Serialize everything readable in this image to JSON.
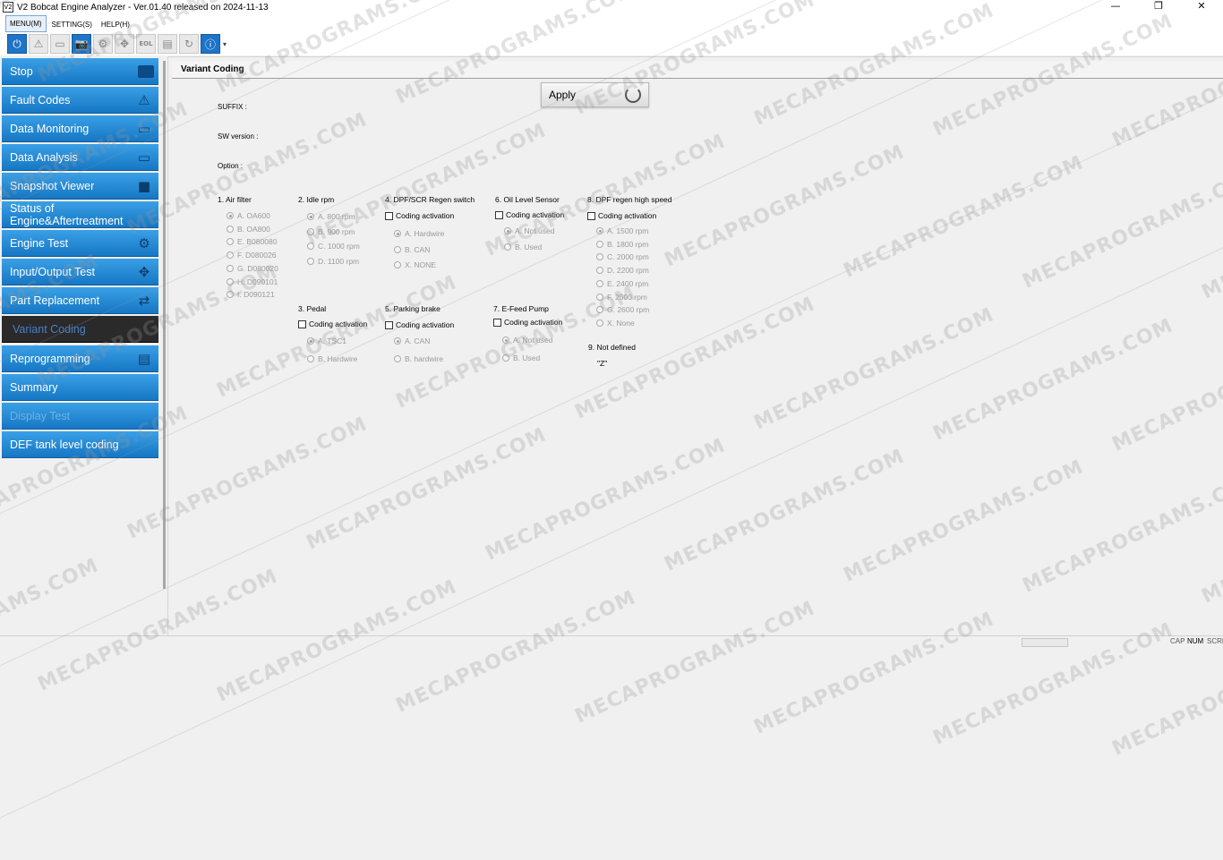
{
  "window": {
    "app_icon_text": "V2",
    "title": "V2 Bobcat Engine Analyzer - Ver.01.40 released on 2024-11-13",
    "controls": [
      "—",
      "❐",
      "✕"
    ]
  },
  "menu": [
    "MENU(M)",
    "SETTING(S)",
    "HELP(H)"
  ],
  "toolbar": [
    {
      "icon": "power-icon",
      "glyph": "⏻"
    },
    {
      "icon": "warning-icon",
      "glyph": "⚠"
    },
    {
      "icon": "monitor-icon",
      "glyph": "▭"
    },
    {
      "icon": "camera-icon",
      "glyph": "📷"
    },
    {
      "icon": "engine-icon",
      "glyph": "⚙"
    },
    {
      "icon": "io-icon",
      "glyph": "✥"
    },
    {
      "icon": "eol-icon",
      "glyph": "EOL"
    },
    {
      "icon": "program-icon",
      "glyph": "▤"
    },
    {
      "icon": "refresh-icon",
      "glyph": "↻"
    },
    {
      "icon": "info-icon",
      "glyph": "ⓘ"
    }
  ],
  "toolbar_more": "▾",
  "sidebar": {
    "items": [
      {
        "label": "Stop",
        "icon": "stop-icon",
        "glyph": ""
      },
      {
        "label": "Fault Codes",
        "icon": "warning-icon",
        "glyph": "⚠"
      },
      {
        "label": "Data Monitoring",
        "icon": "monitor-icon",
        "glyph": "▭"
      },
      {
        "label": "Data Analysis",
        "icon": "monitor-icon",
        "glyph": "▭"
      },
      {
        "label": "Snapshot Viewer",
        "icon": "camera-icon",
        "glyph": "■"
      },
      {
        "label": "Status of Engine&Aftertreatment",
        "icon": "",
        "glyph": ""
      },
      {
        "label": "Engine Test",
        "icon": "engine-test-icon",
        "glyph": "⚙"
      },
      {
        "label": "Input/Output Test",
        "icon": "io-icon",
        "glyph": "✥"
      },
      {
        "label": "Part Replacement",
        "icon": "part-replace-icon",
        "glyph": "⇄"
      },
      {
        "label": "Variant Coding",
        "icon": "",
        "glyph": ""
      },
      {
        "label": "Reprogramming",
        "icon": "program-icon",
        "glyph": "▤"
      },
      {
        "label": "Summary",
        "icon": "",
        "glyph": ""
      },
      {
        "label": "Display Test",
        "icon": "",
        "glyph": ""
      },
      {
        "label": "DEF tank level coding",
        "icon": "",
        "glyph": ""
      }
    ]
  },
  "panel": {
    "title": "Variant Coding",
    "suffix_label": "SUFFIX :",
    "sw_version_label": "SW version :",
    "option_label": "Option :",
    "apply_label": "Apply"
  },
  "groups": {
    "air_filter": {
      "title": "1. Air filter",
      "options": [
        "A. OA600",
        "B. OA800",
        "E. B080080",
        "F. D080026",
        "G. D080020",
        "H. D090101",
        "I. D090121"
      ],
      "checked": 0
    },
    "idle_rpm": {
      "title": "2. Idle rpm",
      "options": [
        "A. 800 rpm",
        "B. 900 rpm",
        "C. 1000 rpm",
        "D. 1100 rpm"
      ],
      "checked": 0
    },
    "pedal": {
      "title": "3. Pedal",
      "activation": "Coding activation",
      "options": [
        "A. TSC1",
        "B. Hardwire"
      ],
      "checked": 0
    },
    "dpf_switch": {
      "title": "4. DPF/SCR Regen switch",
      "activation": "Coding activation",
      "options": [
        "A. Hardwire",
        "B. CAN",
        "X. NONE"
      ],
      "checked": 0
    },
    "parking_brake": {
      "title": "5. Parking brake",
      "activation": "Coding activation",
      "options": [
        "A. CAN",
        "B. hardwire"
      ],
      "checked": 0
    },
    "oil_level": {
      "title": "6. Oil Level Sensor",
      "activation": "Coding activation",
      "options": [
        "A. Not used",
        "B. Used"
      ],
      "checked": 0
    },
    "efeed_pump": {
      "title": "7. E-Feed Pump",
      "activation": "Coding activation",
      "options": [
        "A. Not used",
        "B. Used"
      ],
      "checked": 0
    },
    "dpf_regen_speed": {
      "title": "8. DPF regen high speed",
      "activation": "Coding activation",
      "options": [
        "A. 1500 rpm",
        "B. 1800 rpm",
        "C. 2000 rpm",
        "D. 2200 rpm",
        "E. 2400 rpm",
        "F. 2500 rpm",
        "G. 2600 rpm",
        "X. None"
      ],
      "checked": 0
    },
    "not_defined": {
      "title": "9. Not defined",
      "value": "\"Z\""
    }
  },
  "statusbar": {
    "indicators": [
      "CAP",
      "NUM",
      "SCRL"
    ],
    "active": "NUM"
  },
  "watermark": "MECAPROGRAMS.COM"
}
